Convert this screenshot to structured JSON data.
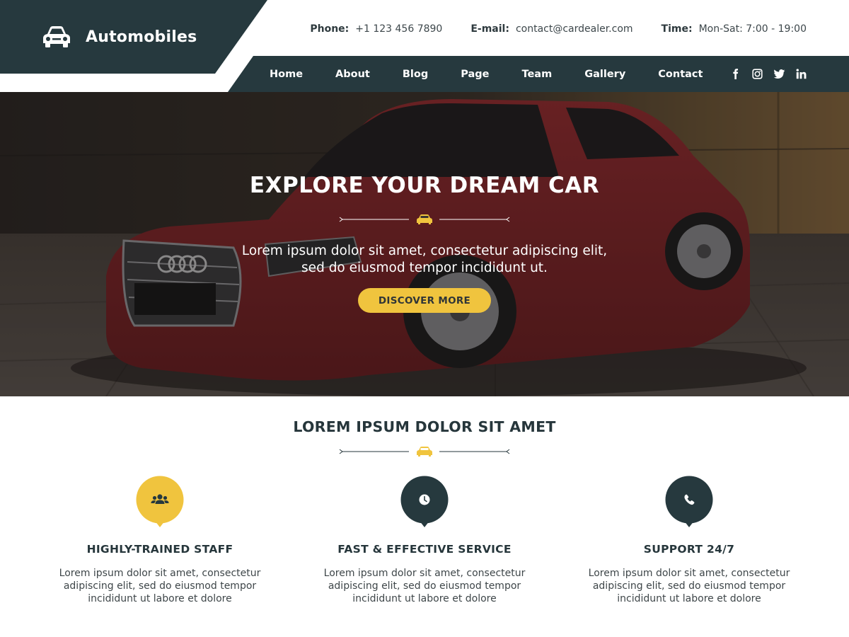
{
  "brand": {
    "name": "Automobiles",
    "icon": "car-icon"
  },
  "contact": [
    {
      "label": "Phone:",
      "value": "+1 123 456 7890"
    },
    {
      "label": "E-mail:",
      "value": "contact@cardealer.com"
    },
    {
      "label": "Time:",
      "value": "Mon-Sat: 7:00 - 19:00"
    }
  ],
  "nav": {
    "items": [
      "Home",
      "About",
      "Blog",
      "Page",
      "Team",
      "Gallery",
      "Contact"
    ],
    "social": [
      "facebook-icon",
      "instagram-icon",
      "twitter-icon",
      "linkedin-icon"
    ]
  },
  "hero": {
    "title": "EXPLORE YOUR DREAM CAR",
    "text_line1": "Lorem ipsum dolor sit amet, consectetur adipiscing elit,",
    "text_line2": "sed do eiusmod tempor incididunt ut.",
    "button": "DISCOVER MORE"
  },
  "section": {
    "title": "LOREM IPSUM DOLOR SIT AMET",
    "features": [
      {
        "title": "HIGHLY-TRAINED STAFF",
        "icon": "users-icon",
        "color": "#f0c43e",
        "line1": "Lorem ipsum dolor sit amet, consectetur",
        "line2": "adipiscing elit, sed do eiusmod tempor",
        "line3": "incididunt ut labore et dolore"
      },
      {
        "title": "FAST & EFFECTIVE SERVICE",
        "icon": "clock-icon",
        "color": "#26393e",
        "line1": "Lorem ipsum dolor sit amet, consectetur",
        "line2": "adipiscing elit, sed do eiusmod tempor",
        "line3": "incididunt ut labore et dolore"
      },
      {
        "title": "SUPPORT 24/7",
        "icon": "phone-icon",
        "color": "#26393e",
        "line1": "Lorem ipsum dolor sit amet, consectetur",
        "line2": "adipiscing elit, sed do eiusmod tempor",
        "line3": "incididunt ut labore et dolore"
      }
    ]
  },
  "colors": {
    "primary": "#26393e",
    "accent": "#f0c43e"
  }
}
